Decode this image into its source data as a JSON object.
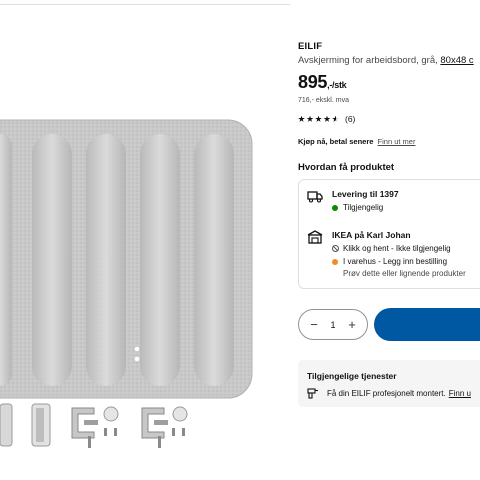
{
  "product": {
    "name": "EILIF",
    "description": "Avskjerming for arbeidsbord, grå,",
    "size_link": "80x48 c",
    "price_main": "895",
    "price_unit": ",-/stk",
    "price_ex_vat": "716,- ekskl. mva",
    "rating_value": 4.5,
    "rating_count": "(6)"
  },
  "payment": {
    "text": "Kjøp nå, betal senere",
    "link": "Finn ut mer"
  },
  "delivery_section": {
    "title": "Hvordan få produktet",
    "delivery": {
      "title": "Levering til 1397",
      "status": "Tilgjengelig",
      "icon": "truck-icon",
      "status_color": "#0a8a00"
    },
    "store": {
      "title": "IKEA på Karl Johan",
      "click_collect": "Klikk og hent - Ikke tilgjengelig",
      "in_store": "I varehus - Legg inn bestilling",
      "suggestion": "Prøv dette eller lignende produkter",
      "icon": "store-icon",
      "status_color": "#f28b27"
    }
  },
  "cart": {
    "quantity": "1",
    "minus": "−",
    "plus": "+",
    "button_color": "#0058a3"
  },
  "services": {
    "title": "Tilgjengelige tjenester",
    "assembly_text": "Få din EILIF profesjonelt montert.",
    "assembly_link": "Finn u"
  }
}
